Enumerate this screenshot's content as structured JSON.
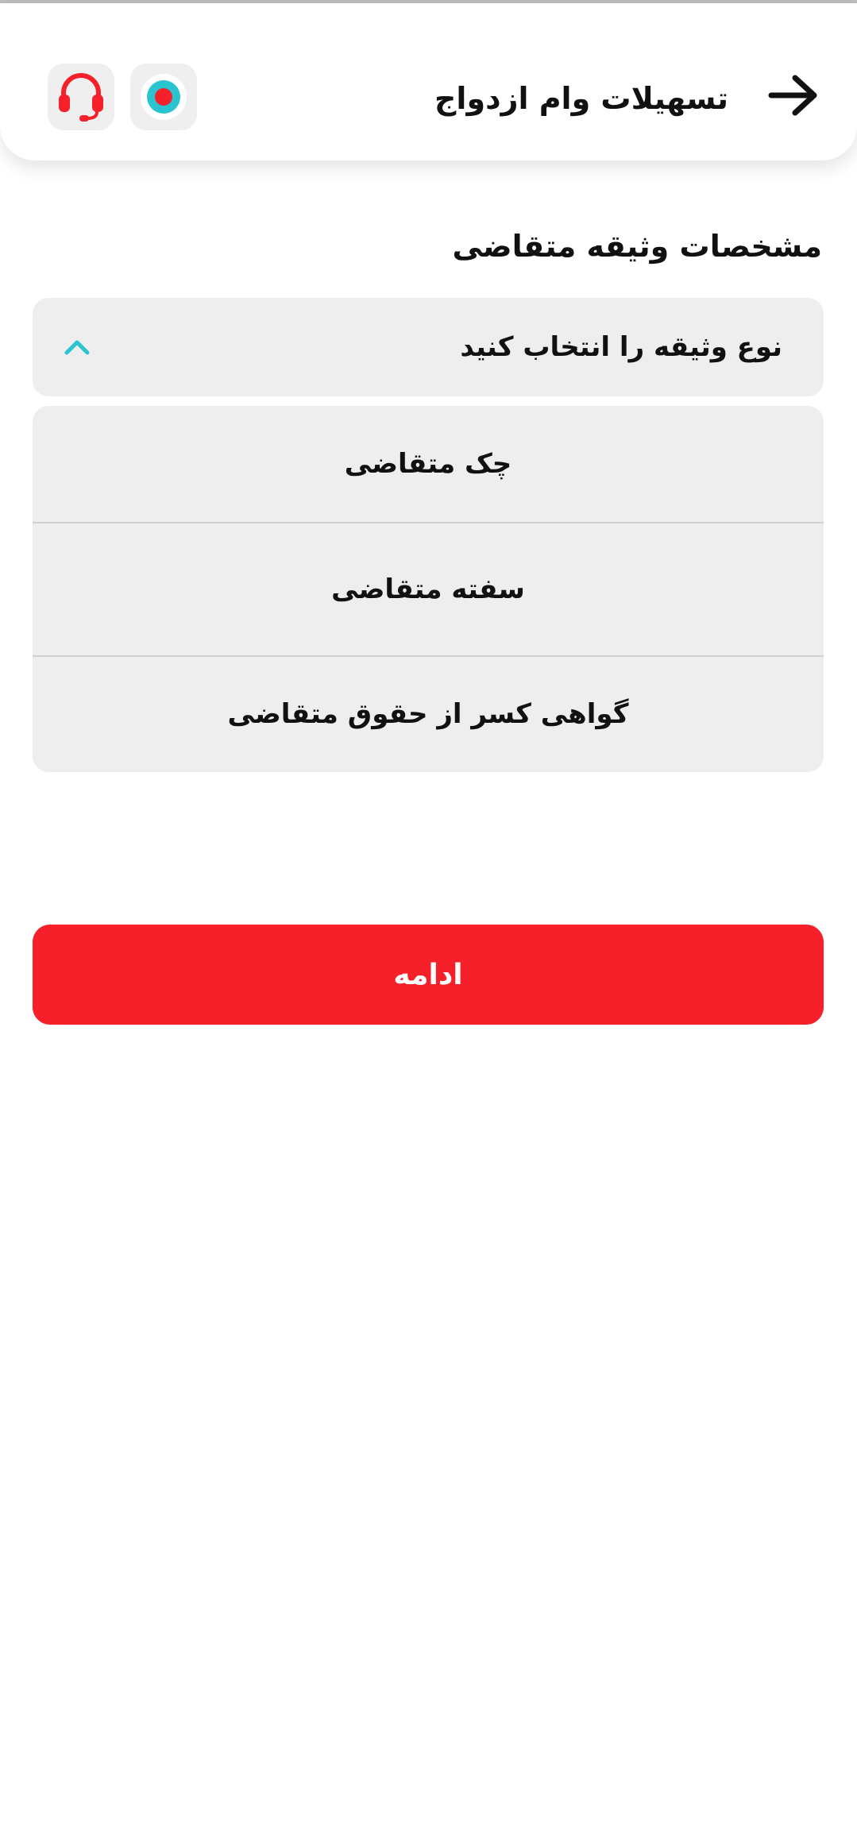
{
  "header": {
    "title": "تسهیلات وام ازدواج",
    "back_icon": "arrow-right-icon",
    "support_icon": "headset-icon",
    "record_icon": "record-icon"
  },
  "section": {
    "title": "مشخصات وثیقه متقاضی"
  },
  "dropdown": {
    "placeholder": "نوع وثیقه را انتخاب کنید",
    "chevron_icon": "chevron-up-icon",
    "options": [
      {
        "label": "چک متقاضی"
      },
      {
        "label": "سفته متقاضی"
      },
      {
        "label": "گواهی کسر از حقوق متقاضی"
      }
    ]
  },
  "actions": {
    "continue_label": "ادامه"
  },
  "colors": {
    "primary_red": "#f5202a",
    "accent_teal": "#29c4cf",
    "surface_gray": "#eeeeee"
  }
}
